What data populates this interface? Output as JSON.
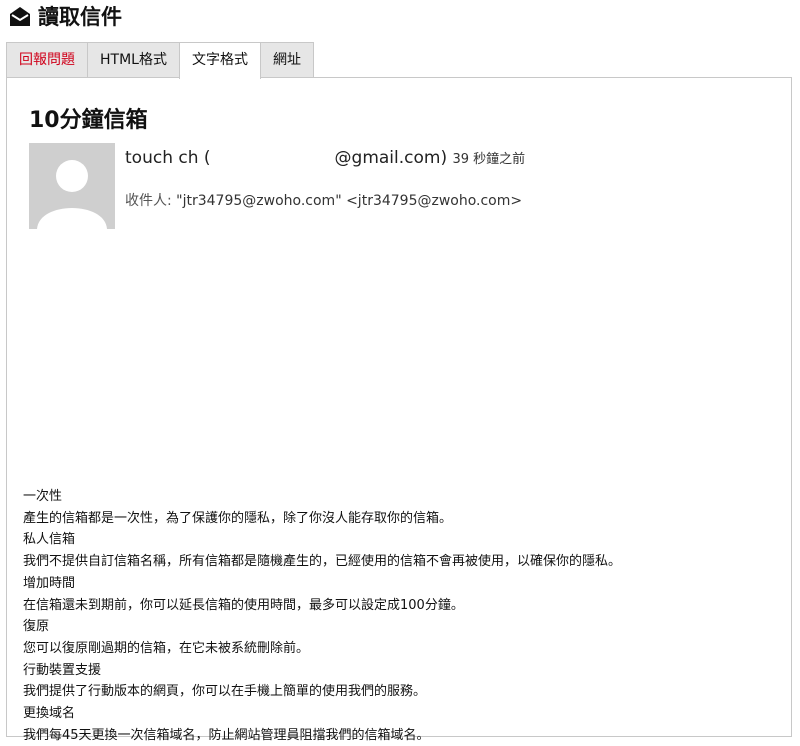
{
  "header": {
    "title": "讀取信件",
    "icon": "envelope-open-icon"
  },
  "tabs": [
    {
      "label": "回報問題",
      "state": "report"
    },
    {
      "label": "HTML格式",
      "state": "normal"
    },
    {
      "label": "文字格式",
      "state": "active"
    },
    {
      "label": "網址",
      "state": "normal"
    }
  ],
  "message": {
    "mailbox_name": "10分鐘信箱",
    "avatar": "default-avatar",
    "sender_name_prefix": "touch ch (",
    "sender_email_suffix": "@gmail.com)",
    "time_ago": "39 秒鐘之前",
    "recipient_label": "收件人:",
    "recipient_value": "\"jtr34795@zwoho.com\" <jtr34795@zwoho.com>"
  },
  "body_lines": [
    "一次性",
    "產生的信箱都是一次性，為了保護你的隱私，除了你沒人能存取你的信箱。",
    "私人信箱",
    "我們不提供自訂信箱名稱，所有信箱都是隨機產生的，已經使用的信箱不會再被使用，以確保你的隱私。",
    "增加時間",
    "在信箱還未到期前，你可以延長信箱的使用時間，最多可以設定成100分鐘。",
    "復原",
    "您可以復原剛過期的信箱，在它未被系統刪除前。",
    "行動裝置支援",
    "我們提供了行動版本的網頁，你可以在手機上簡單的使用我們的服務。",
    "更換域名",
    "我們每45天更換一次信箱域名，防止網站管理員阻擋我們的信箱域名。"
  ],
  "colors": {
    "report_tab_text": "#d0021b",
    "tab_background": "#e6e6e6",
    "border": "#c8c8c8",
    "avatar_background": "#cfcfcf"
  }
}
